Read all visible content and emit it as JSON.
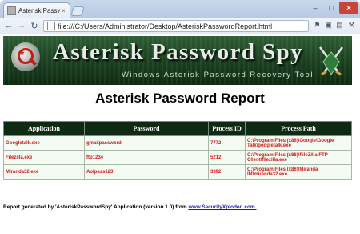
{
  "browser": {
    "tab_title": "Asterisk Password Report...",
    "tab_close": "×",
    "url": "file:///C:/Users/Administrator/Desktop/AsteriskPasswordReport.html",
    "window_min": "‒",
    "window_max": "□",
    "window_close": "✕"
  },
  "banner": {
    "title": "Asterisk Password Spy",
    "subtitle": "Windows Asterisk Password Recovery Tool"
  },
  "report": {
    "heading": "Asterisk Password Report",
    "columns": [
      "Application",
      "Password",
      "Process ID",
      "Process Path"
    ],
    "rows": [
      {
        "application": "Googletalk.exe",
        "password": "gmailpassword",
        "pid": "7772",
        "path": "C:\\Program Files (x86)\\Google\\Google Talk\\googletalk.exe"
      },
      {
        "application": "Filezilla.exe",
        "password": "ftp1234",
        "pid": "5212",
        "path": "C:\\Program Files (x86)\\FileZilla FTP Client\\filezilla.exe"
      },
      {
        "application": "Miranda32.exe",
        "password": "Aolpass123",
        "pid": "3392",
        "path": "C:\\Program Files (x86)\\Miranda IM\\miranda32.exe"
      }
    ]
  },
  "footer": {
    "text": "Report generated by 'AsteriskPasswordSpy' Application (version 1.0) from ",
    "link": "www.SecurityXploded.com."
  },
  "colors": {
    "banner_green": "#1e4423",
    "header_dark_green": "#0e2a12",
    "cell_text_red": "#d21a1a",
    "link_blue": "#1a1aa8"
  }
}
